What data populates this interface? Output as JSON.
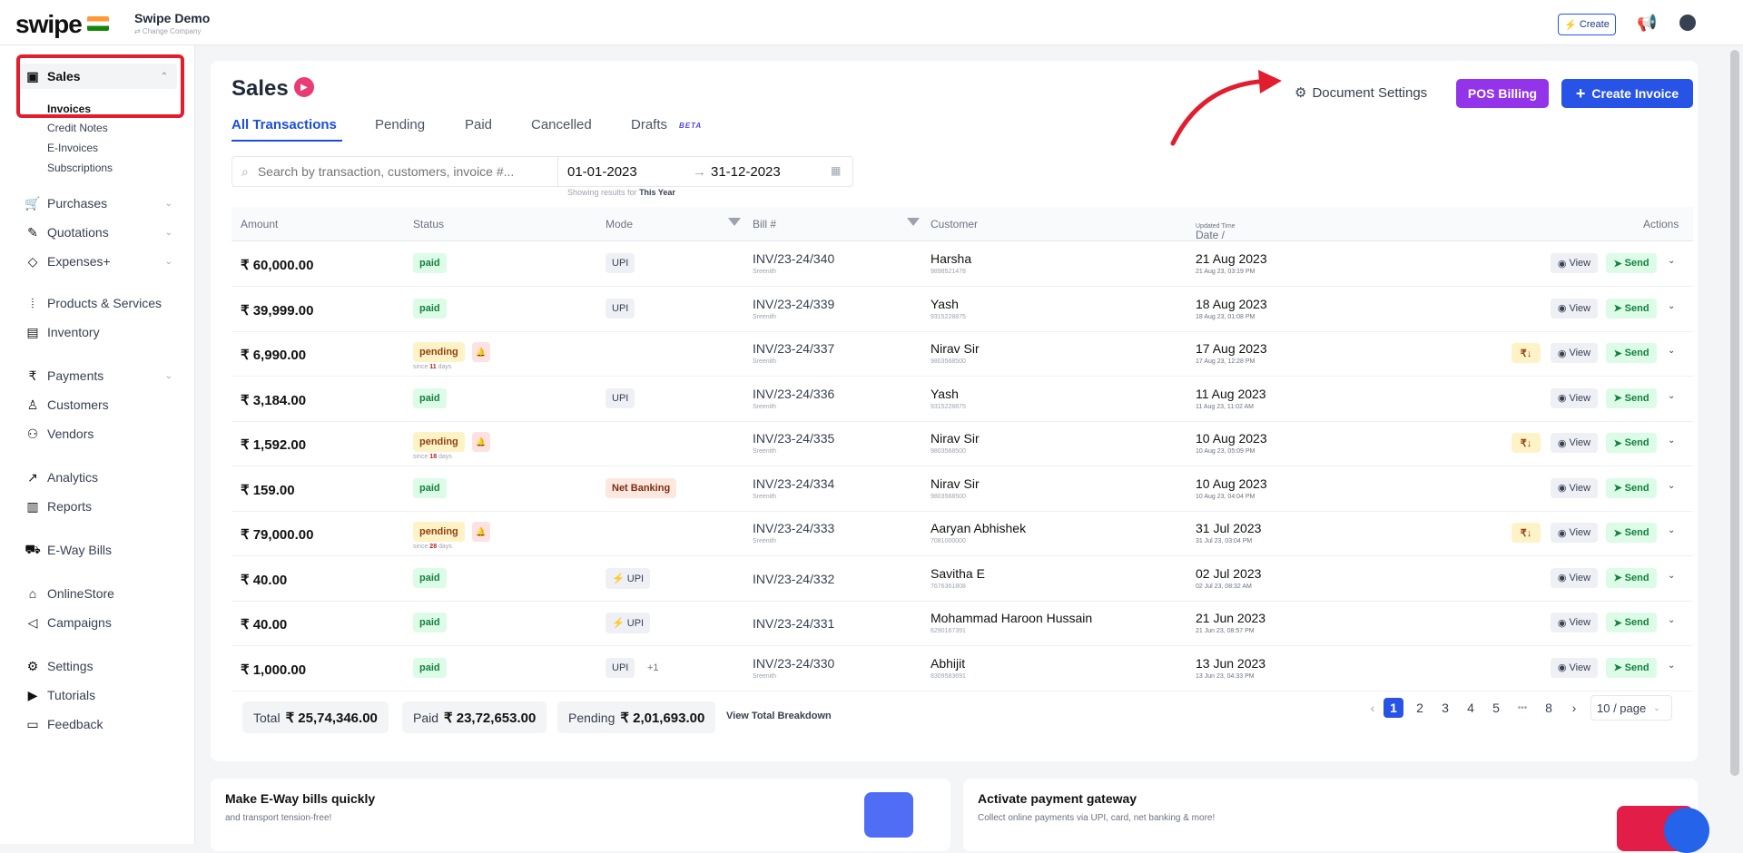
{
  "brand": {
    "logo": "swipe",
    "company": "Swipe Demo",
    "change": "⇄ Change Company"
  },
  "top": {
    "create": "Create"
  },
  "sidebar": {
    "sales": "Sales",
    "subs": [
      "Invoices",
      "Credit Notes",
      "E-Invoices",
      "Subscriptions"
    ],
    "items": [
      "Purchases",
      "Quotations",
      "Expenses+",
      "Products & Services",
      "Inventory",
      "Payments",
      "Customers",
      "Vendors",
      "Analytics",
      "Reports",
      "E-Way Bills",
      "OnlineStore",
      "Campaigns",
      "Settings",
      "Tutorials",
      "Feedback"
    ]
  },
  "header": {
    "title": "Sales",
    "doc_settings": "Document Settings",
    "pos": "POS Billing",
    "create_invoice": "Create Invoice"
  },
  "tabs": [
    "All Transactions",
    "Pending",
    "Paid",
    "Cancelled",
    "Drafts"
  ],
  "beta": "BETA",
  "search": {
    "placeholder": "Search by transaction, customers, invoice #...",
    "from": "01-01-2023",
    "to": "31-12-2023",
    "showing_prefix": "Showing results for",
    "showing_value": "This Year"
  },
  "columns": {
    "amount": "Amount",
    "status": "Status",
    "mode": "Mode",
    "bill": "Bill #",
    "customer": "Customer",
    "date": "Date /",
    "date_sub": "Updated Time",
    "actions": "Actions"
  },
  "actions": {
    "view": "View",
    "send": "Send",
    "reminder": "₹↓"
  },
  "rows": [
    {
      "amount": "₹ 60,000.00",
      "status": "paid",
      "since": "",
      "mode": "UPI",
      "mode_extra": "",
      "bill": "INV/23-24/340",
      "bill_sub": "Sreenith",
      "customer": "Harsha",
      "phone": "9898521478",
      "date": "21 Aug 2023",
      "time": "21 Aug 23, 03:19 PM"
    },
    {
      "amount": "₹ 39,999.00",
      "status": "paid",
      "since": "",
      "mode": "UPI",
      "mode_extra": "",
      "bill": "INV/23-24/339",
      "bill_sub": "Sreenith",
      "customer": "Yash",
      "phone": "9315228875",
      "date": "18 Aug 2023",
      "time": "18 Aug 23, 01:08 PM"
    },
    {
      "amount": "₹ 6,990.00",
      "status": "pending",
      "since": "11",
      "mode": "",
      "mode_extra": "",
      "bill": "INV/23-24/337",
      "bill_sub": "Sreenith",
      "customer": "Nirav Sir",
      "phone": "9803568500",
      "date": "17 Aug 2023",
      "time": "17 Aug 23, 12:28 PM"
    },
    {
      "amount": "₹ 3,184.00",
      "status": "paid",
      "since": "",
      "mode": "UPI",
      "mode_extra": "",
      "bill": "INV/23-24/336",
      "bill_sub": "Sreenith",
      "customer": "Yash",
      "phone": "9315228875",
      "date": "11 Aug 2023",
      "time": "11 Aug 23, 11:02 AM"
    },
    {
      "amount": "₹ 1,592.00",
      "status": "pending",
      "since": "18",
      "mode": "",
      "mode_extra": "",
      "bill": "INV/23-24/335",
      "bill_sub": "Sreenith",
      "customer": "Nirav Sir",
      "phone": "9803568500",
      "date": "10 Aug 2023",
      "time": "10 Aug 23, 05:09 PM"
    },
    {
      "amount": "₹ 159.00",
      "status": "paid",
      "since": "",
      "mode": "Net Banking",
      "mode_extra": "",
      "bill": "INV/23-24/334",
      "bill_sub": "Sreenith",
      "customer": "Nirav Sir",
      "phone": "9803568500",
      "date": "10 Aug 2023",
      "time": "10 Aug 23, 04:04 PM"
    },
    {
      "amount": "₹ 79,000.00",
      "status": "pending",
      "since": "28",
      "mode": "",
      "mode_extra": "",
      "bill": "INV/23-24/333",
      "bill_sub": "Sreenith",
      "customer": "Aaryan Abhishek",
      "phone": "7081000000",
      "date": "31 Jul 2023",
      "time": "31 Jul 23, 03:04 PM"
    },
    {
      "amount": "₹ 40.00",
      "status": "paid",
      "since": "",
      "mode": "⚡ UPI",
      "mode_extra": "",
      "bill": "INV/23-24/332",
      "bill_sub": "",
      "customer": "Savitha E",
      "phone": "7676361808",
      "date": "02 Jul 2023",
      "time": "02 Jul 23, 08:32 AM"
    },
    {
      "amount": "₹ 40.00",
      "status": "paid",
      "since": "",
      "mode": "⚡ UPI",
      "mode_extra": "",
      "bill": "INV/23-24/331",
      "bill_sub": "",
      "customer": "Mohammad Haroon Hussain",
      "phone": "6290167391",
      "date": "21 Jun 2023",
      "time": "21 Jun 23, 08:57 PM"
    },
    {
      "amount": "₹ 1,000.00",
      "status": "paid",
      "since": "",
      "mode": "UPI",
      "mode_extra": "+1",
      "bill": "INV/23-24/330",
      "bill_sub": "Sreenith",
      "customer": "Abhijit",
      "phone": "8309583691",
      "date": "13 Jun 2023",
      "time": "13 Jun 23, 04:33 PM"
    }
  ],
  "totals": {
    "total_label": "Total",
    "total": "₹ 25,74,346.00",
    "paid_label": "Paid",
    "paid": "₹ 23,72,653.00",
    "pending_label": "Pending",
    "pending": "₹ 2,01,693.00",
    "breakdown": "View Total Breakdown"
  },
  "pagination": {
    "pages": [
      "1",
      "2",
      "3",
      "4",
      "5",
      "•••",
      "8"
    ],
    "per_page": "10 / page"
  },
  "promos": [
    {
      "title": "Make E-Way bills quickly",
      "text": "and transport tension-free!"
    },
    {
      "title": "Activate payment gateway",
      "text": "Collect online payments via UPI, card, net banking & more!"
    }
  ],
  "colors": {
    "primary": "#2754e6",
    "pos": "#9333ea",
    "highlight": "#e11d2e"
  }
}
